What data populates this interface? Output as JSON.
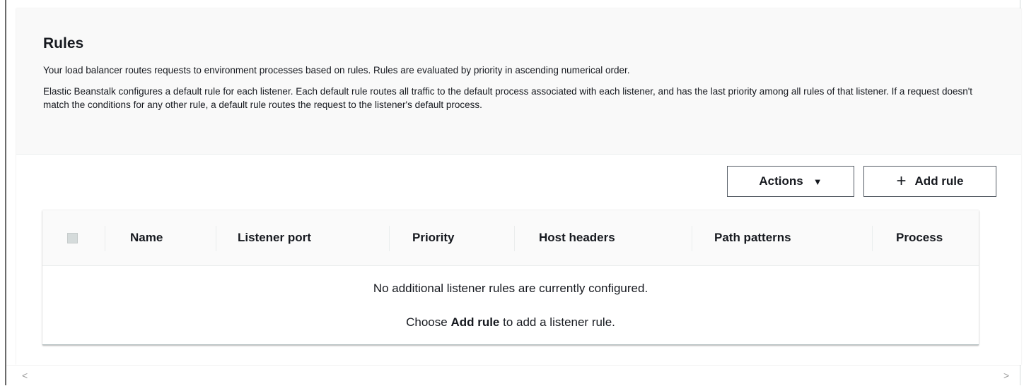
{
  "section": {
    "title": "Rules",
    "description_1": "Your load balancer routes requests to environment processes based on rules. Rules are evaluated by priority in ascending numerical order.",
    "description_2": "Elastic Beanstalk configures a default rule for each listener. Each default rule routes all traffic to the default process associated with each listener, and has the last priority among all rules of that listener. If a request doesn't match the conditions for any other rule, a default rule routes the request to the listener's default process."
  },
  "toolbar": {
    "actions_label": "Actions",
    "actions_caret": "▼",
    "add_plus": "+",
    "add_label": "Add rule"
  },
  "table": {
    "columns": [
      "Name",
      "Listener port",
      "Priority",
      "Host headers",
      "Path patterns",
      "Process"
    ],
    "empty_message": "No additional listener rules are currently configured.",
    "empty_hint_prefix": "Choose",
    "empty_hint_bold": "Add rule",
    "empty_hint_suffix": "to add a listener rule."
  },
  "scrollbar": {
    "left_arrow": "<",
    "right_arrow": ">"
  }
}
